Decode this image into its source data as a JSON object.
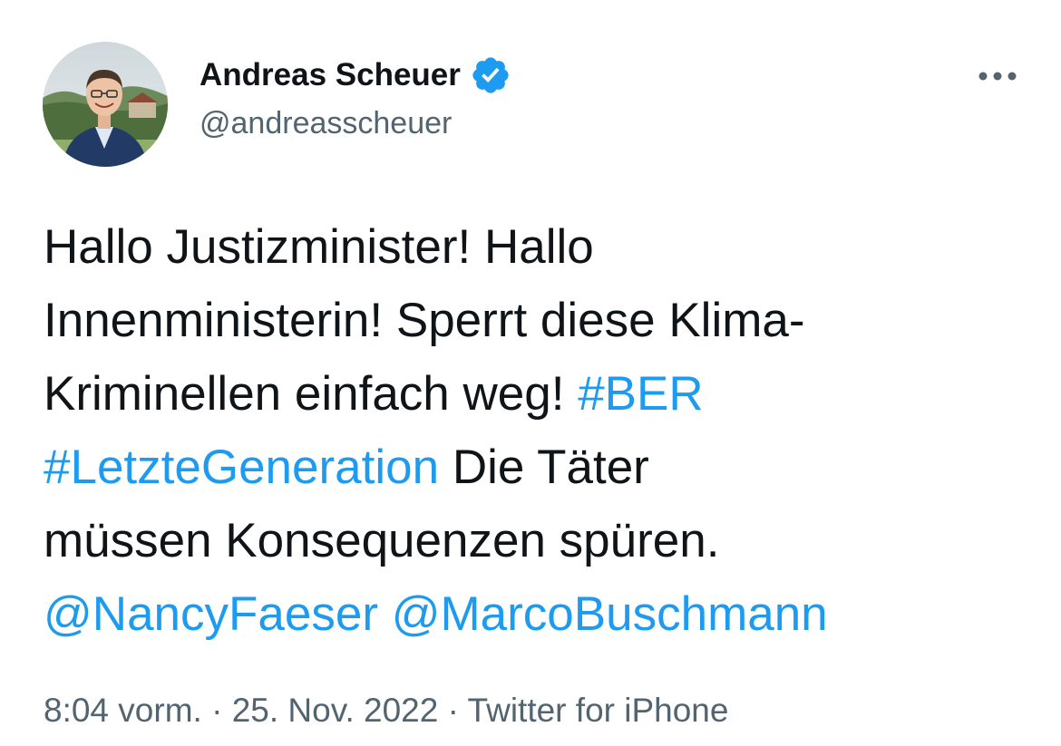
{
  "author": {
    "display_name": "Andreas Scheuer",
    "handle": "@andreasscheuer",
    "verified": true,
    "avatar_icon": "profile-photo"
  },
  "more_icon": "more-horizontal-icon",
  "tweet": {
    "lines": [
      [
        {
          "text": "Hallo Justizminister! Hallo",
          "type": "text"
        }
      ],
      [
        {
          "text": "Innenministerin! Sperrt diese Klima-",
          "type": "text"
        }
      ],
      [
        {
          "text": "Kriminellen einfach weg! ",
          "type": "text"
        },
        {
          "text": "#BER",
          "type": "hashtag"
        }
      ],
      [
        {
          "text": "#LetzteGeneration",
          "type": "hashtag"
        },
        {
          "text": " Die Täter",
          "type": "text"
        }
      ],
      [
        {
          "text": "müssen Konsequenzen spüren.",
          "type": "text"
        }
      ],
      [
        {
          "text": "@NancyFaeser",
          "type": "mention"
        },
        {
          "text": " ",
          "type": "text"
        },
        {
          "text": "@MarcoBuschmann",
          "type": "mention"
        }
      ]
    ]
  },
  "meta": {
    "time": "8:04 vorm.",
    "separator": " · ",
    "date": "25. Nov. 2022",
    "source": "Twitter for iPhone"
  },
  "colors": {
    "link": "#1d9bf0",
    "text": "#0f1419",
    "secondary": "#536471",
    "verified": "#1d9bf0"
  }
}
